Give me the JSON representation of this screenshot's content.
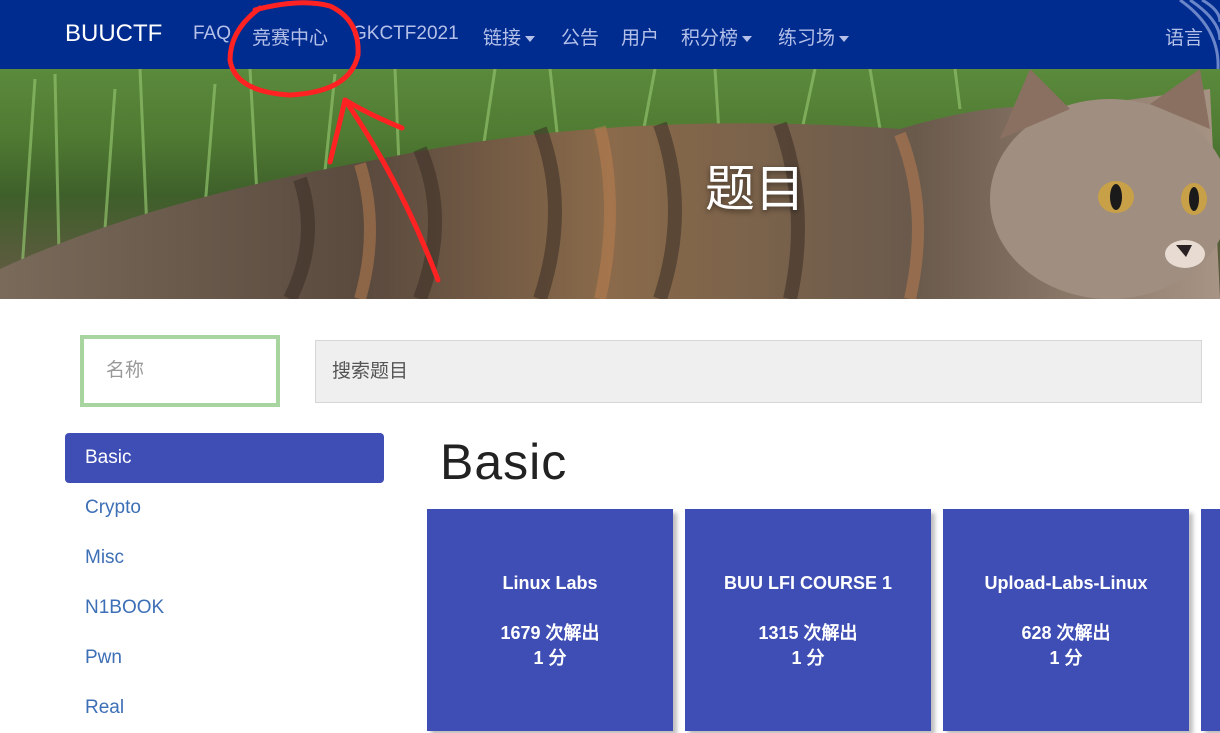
{
  "navbar": {
    "brand": "BUUCTF",
    "items": [
      {
        "label": "FAQ",
        "dropdown": false
      },
      {
        "label": "竞赛中心",
        "dropdown": false
      },
      {
        "label": "GKCTF2021",
        "dropdown": false
      },
      {
        "label": "链接",
        "dropdown": true
      },
      {
        "label": "公告",
        "dropdown": false
      },
      {
        "label": "用户",
        "dropdown": false
      },
      {
        "label": "积分榜",
        "dropdown": true
      },
      {
        "label": "练习场",
        "dropdown": true
      }
    ],
    "language": "语言",
    "bg_color": "#002b8f"
  },
  "hero": {
    "title": "题目"
  },
  "search": {
    "name_placeholder": "名称",
    "search_placeholder": "搜索题目"
  },
  "sidebar": {
    "categories": [
      {
        "label": "Basic",
        "active": true
      },
      {
        "label": "Crypto",
        "active": false
      },
      {
        "label": "Misc",
        "active": false
      },
      {
        "label": "N1BOOK",
        "active": false
      },
      {
        "label": "Pwn",
        "active": false
      },
      {
        "label": "Real",
        "active": false
      }
    ]
  },
  "main": {
    "section_title": "Basic",
    "cards": [
      {
        "name": "Linux Labs",
        "solves": "1679 次解出",
        "points": "1 分"
      },
      {
        "name": "BUU LFI COURSE 1",
        "solves": "1315 次解出",
        "points": "1 分"
      },
      {
        "name": "Upload-Labs-Linux",
        "solves": "628 次解出",
        "points": "1 分"
      }
    ],
    "card_color": "#3f4eb4"
  },
  "annotation": {
    "color": "#ff2222"
  }
}
